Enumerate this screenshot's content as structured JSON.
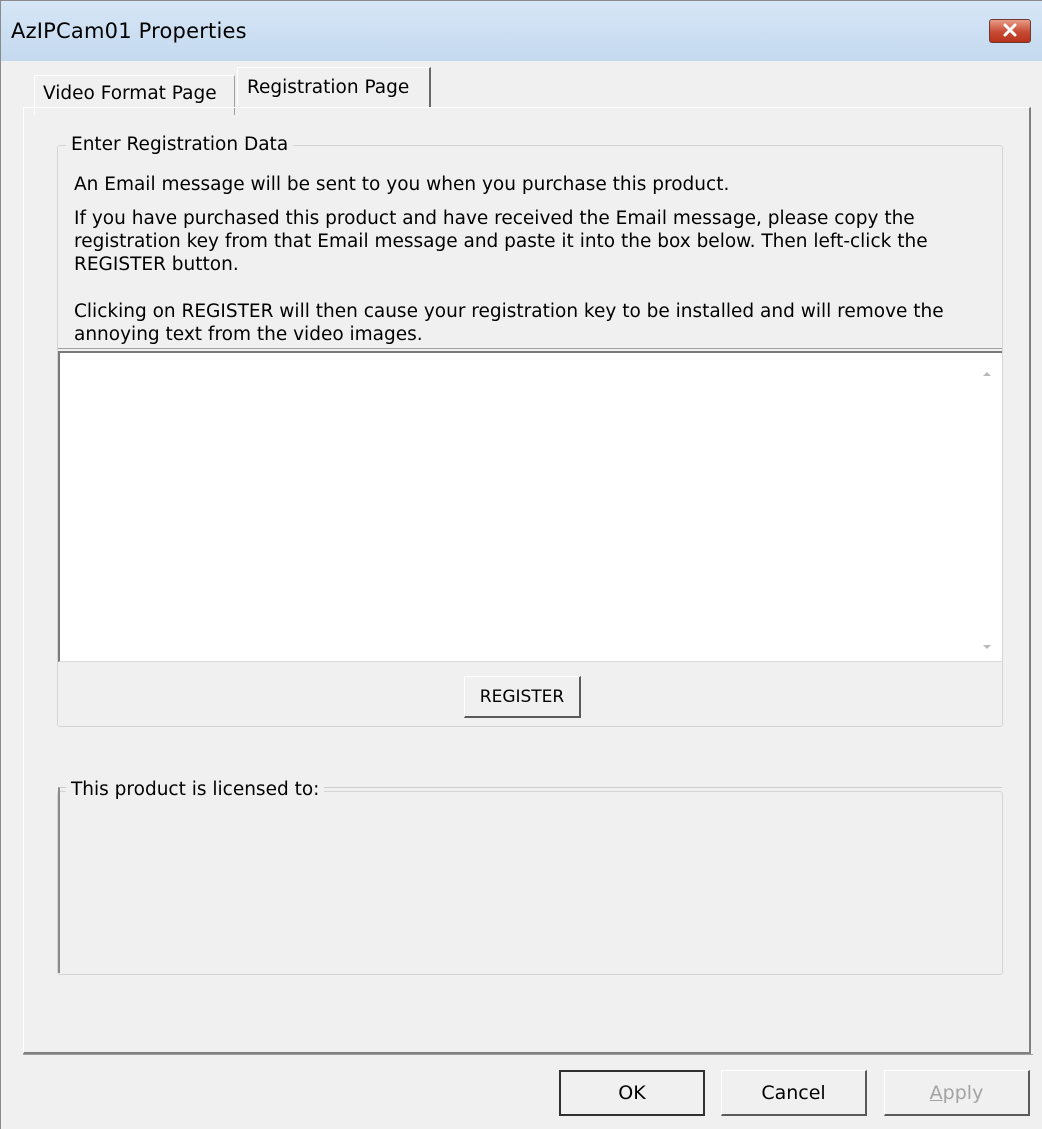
{
  "window": {
    "title": "AzIPCam01 Properties"
  },
  "tabs": [
    {
      "label": "Video Format Page",
      "selected": false
    },
    {
      "label": "Registration Page",
      "selected": true
    }
  ],
  "registration": {
    "group_title": "Enter Registration Data",
    "paragraph_1": "An Email message will be sent to you when you purchase this product.",
    "paragraph_2": "If you have purchased this product and have received the Email message, please copy the registration key from that Email message and paste it into the box below.  Then left-click the REGISTER button.",
    "paragraph_3": "Clicking on REGISTER will then cause your registration key to be installed and will remove the annoying text from the video images.",
    "key_value": "",
    "register_label": "REGISTER"
  },
  "license": {
    "group_title": "This product is licensed to:",
    "value": ""
  },
  "buttons": {
    "ok": "OK",
    "cancel": "Cancel",
    "apply": "Apply",
    "apply_enabled": false
  },
  "colors": {
    "dialog_background": "#f0f0f0",
    "titlebar": "#c4d9ef",
    "close_button": "#c64a33",
    "disabled_text": "#a3a3a3"
  },
  "icons": {
    "close": "close-x-icon",
    "scroll_up": "scroll-up-arrow-icon",
    "scroll_down": "scroll-down-arrow-icon"
  }
}
